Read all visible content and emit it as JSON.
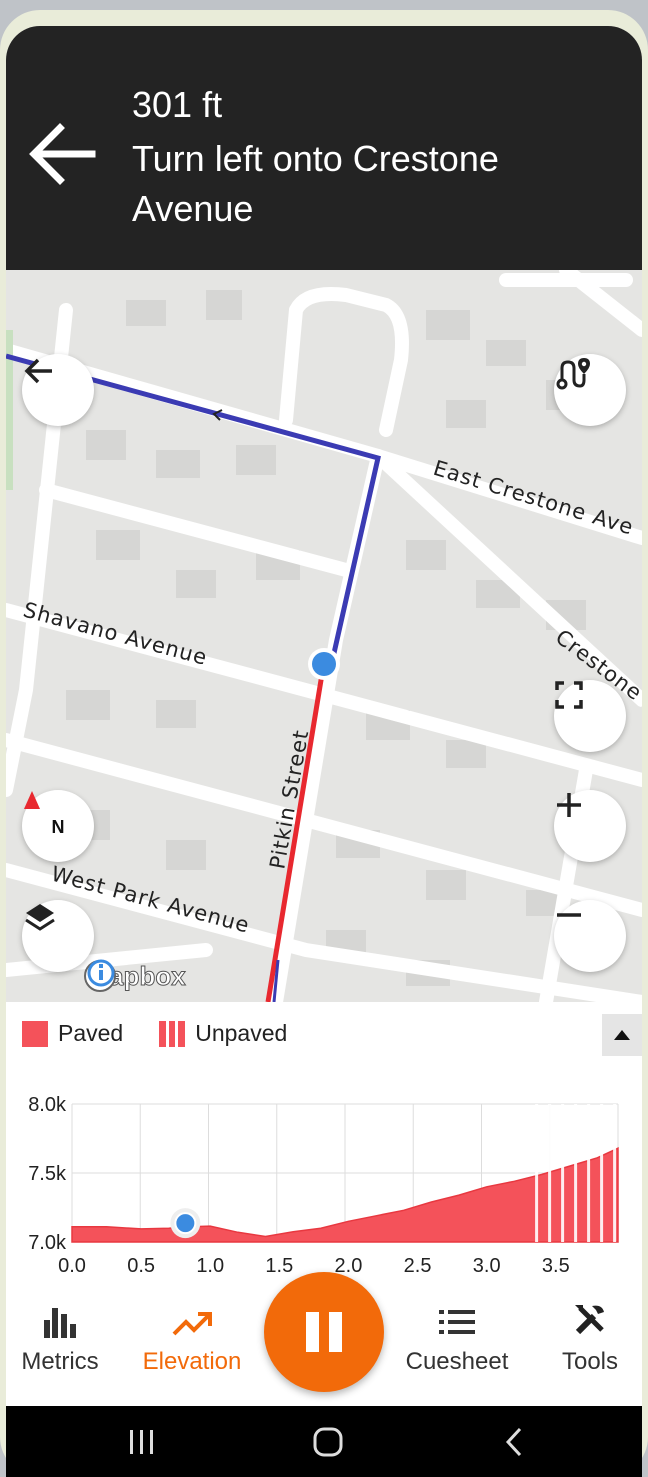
{
  "navigation": {
    "distance": "301 ft",
    "instruction": "Turn left onto Crestone Avenue",
    "maneuver_icon": "arrow-left-icon"
  },
  "map": {
    "streets": {
      "east_crestone": "East Crestone Ave",
      "crestone": "Crestone A",
      "shavano": "Shavano Avenue",
      "pitkin": "Pitkin Street",
      "west_park": "West Park Avenue"
    },
    "compass_label": "N",
    "attribution": "mapbox",
    "colors": {
      "route_upcoming": "#3b3bb3",
      "route_done": "#e8282f",
      "position": "#3b8be0"
    }
  },
  "elevation": {
    "legend": {
      "paved": "Paved",
      "unpaved": "Unpaved"
    },
    "colors": {
      "paved": "#f4525a"
    },
    "chart_data": {
      "type": "area",
      "x": [
        0.0,
        0.25,
        0.5,
        0.7,
        0.85,
        1.0,
        1.2,
        1.4,
        1.6,
        1.8,
        2.0,
        2.2,
        2.4,
        2.6,
        2.8,
        3.0,
        3.2,
        3.4,
        3.6,
        3.8,
        3.95
      ],
      "y": [
        7110,
        7110,
        7095,
        7100,
        7110,
        7115,
        7070,
        7040,
        7075,
        7100,
        7150,
        7190,
        7230,
        7290,
        7340,
        7400,
        7440,
        7490,
        7550,
        7610,
        7680
      ],
      "xticks": [
        "0.0",
        "0.5",
        "1.0",
        "1.5",
        "2.0",
        "2.5",
        "3.0",
        "3.5"
      ],
      "yticks": [
        "7.0k",
        "7.5k",
        "8.0k"
      ],
      "xlim": [
        0,
        3.95
      ],
      "ylim": [
        7000,
        8000
      ],
      "unpaved_range": [
        3.35,
        3.95
      ],
      "marker_x": 0.82,
      "grid": true
    }
  },
  "tabs": [
    {
      "label": "Metrics",
      "icon": "bar-chart-icon",
      "active": false
    },
    {
      "label": "Elevation",
      "icon": "trending-up-icon",
      "active": true
    },
    {
      "label": "Cuesheet",
      "icon": "list-icon",
      "active": false
    },
    {
      "label": "Tools",
      "icon": "tools-icon",
      "active": false
    }
  ],
  "accent_color": "#f26a0a"
}
